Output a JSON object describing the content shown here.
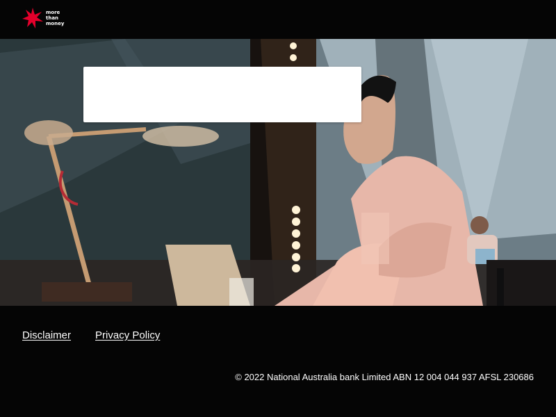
{
  "header": {
    "logo_lines": [
      "more",
      "than",
      "money"
    ],
    "brand_color": "#e4002b"
  },
  "hero": {
    "image_description_icon": "office-worker-laptop-photo",
    "login_card_color": "#ffffff"
  },
  "footer": {
    "links": [
      {
        "label": "Disclaimer"
      },
      {
        "label": "Privacy Policy"
      }
    ],
    "copyright": "© 2022 National Australia bank Limited ABN 12 004 044 937 AFSL 230686"
  }
}
